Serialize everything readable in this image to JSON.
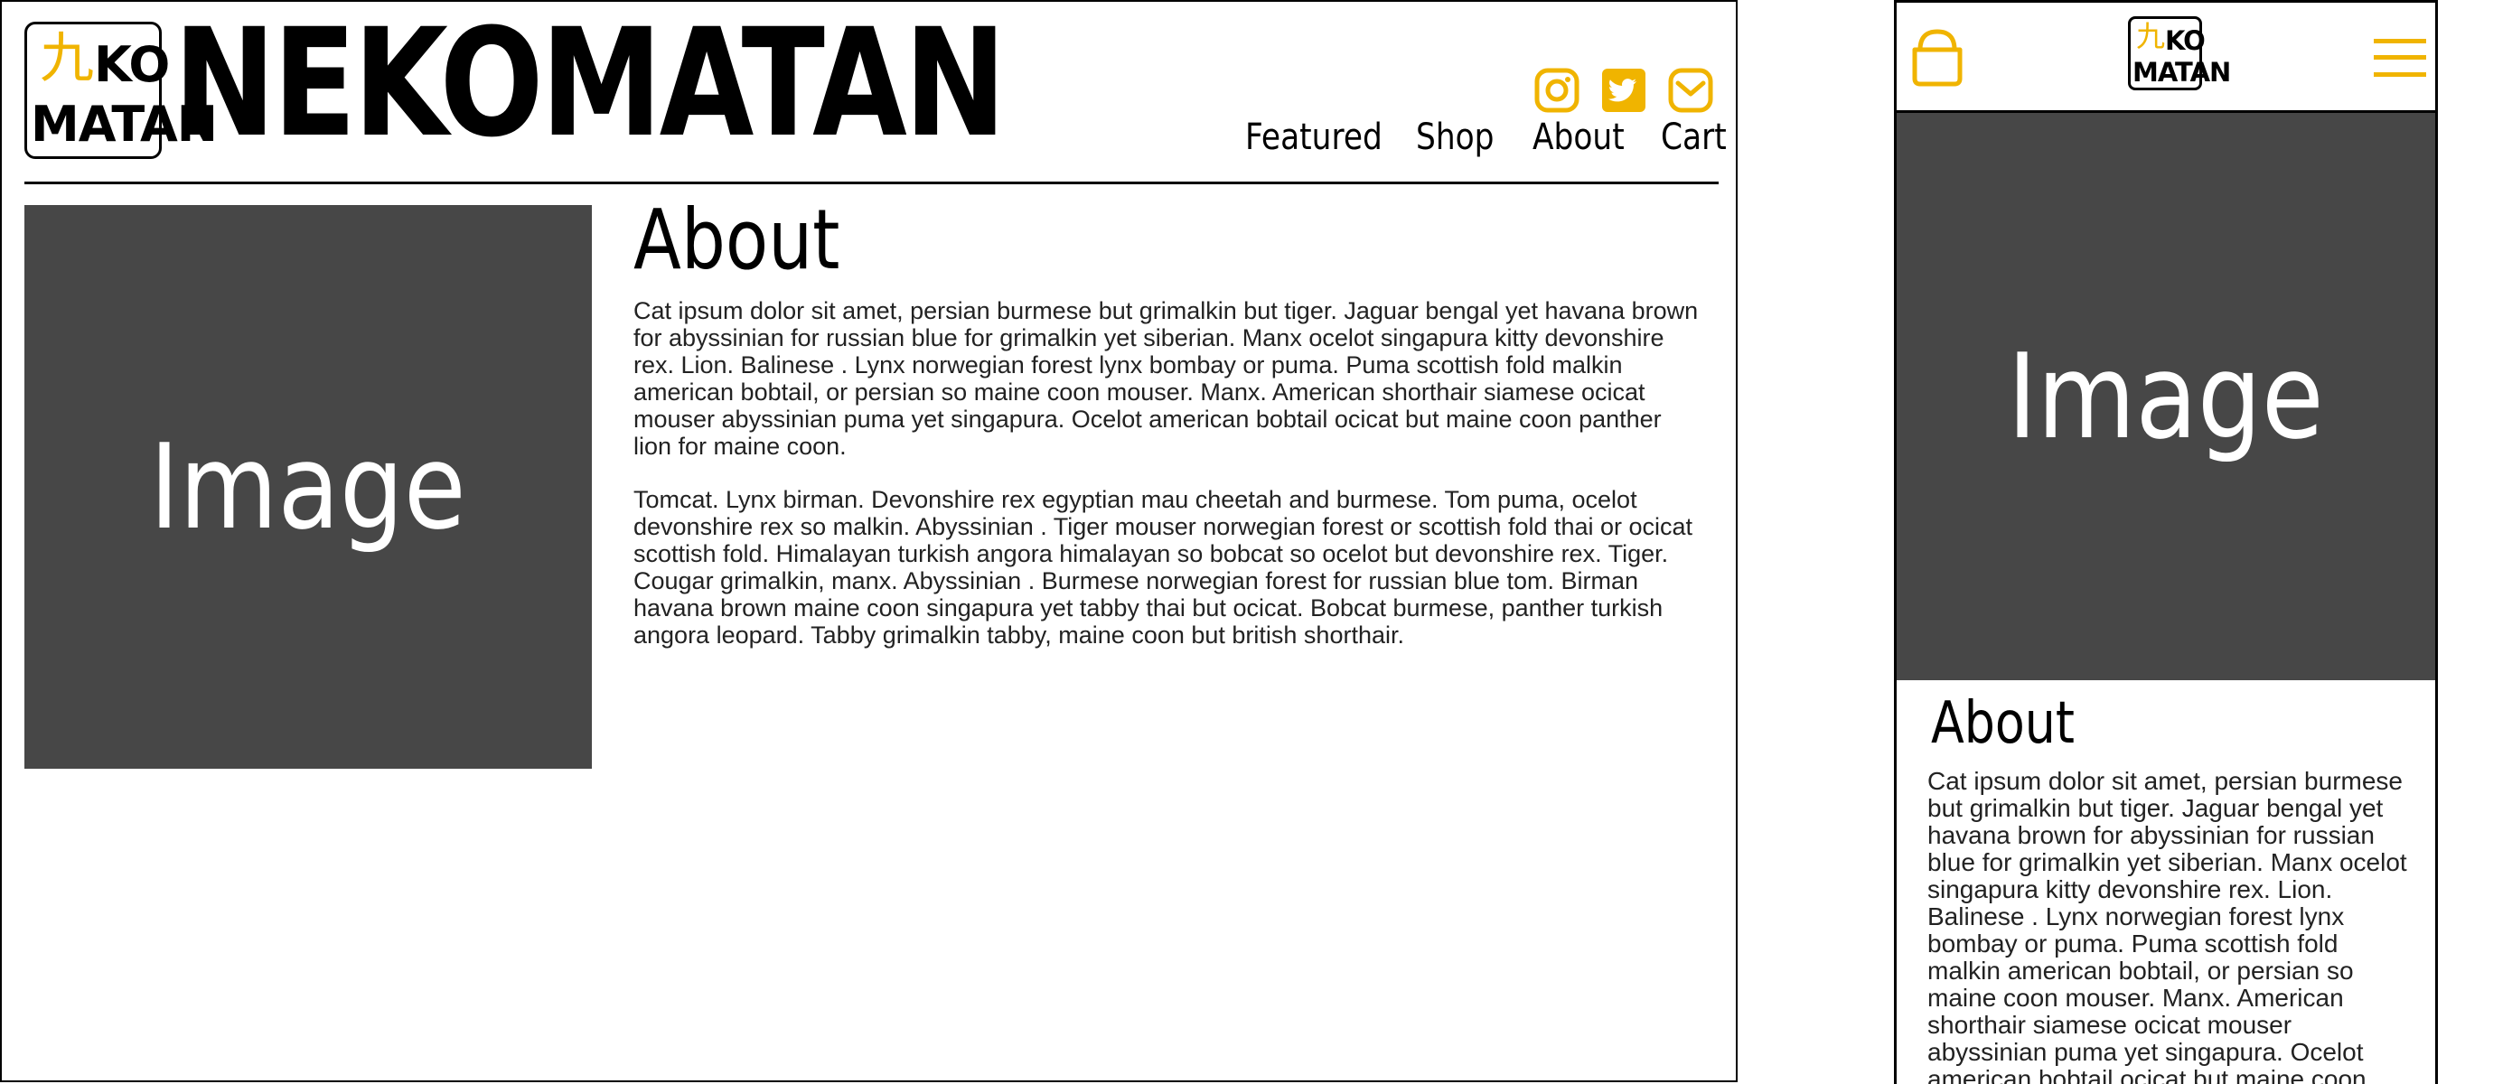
{
  "brand": {
    "logo_top": "KO",
    "logo_bottom": "MATAN",
    "logo_glyph": "九",
    "name": "NEKOMATAN"
  },
  "icons": {
    "instagram": "instagram-icon",
    "twitter": "twitter-icon",
    "mail": "mail-icon",
    "cart": "shopping-bag-icon",
    "menu": "hamburger-menu-icon"
  },
  "colors": {
    "accent": "#f0b400",
    "placeholder": "#474747"
  },
  "nav": {
    "items": [
      "Featured",
      "Shop",
      "About",
      "Cart"
    ]
  },
  "main": {
    "image_label": "Image",
    "title": "About",
    "paragraphs": [
      "Cat ipsum dolor sit amet, persian burmese but grimalkin but tiger. Jaguar bengal yet havana brown for abyssinian for russian blue for grimalkin yet siberian. Manx ocelot singapura kitty devonshire rex. Lion. Balinese . Lynx norwegian forest lynx bombay or puma. Puma scottish fold malkin american bobtail, or persian so maine coon mouser. Manx. American shorthair siamese ocicat mouser abyssinian puma yet singapura. Ocelot american bobtail ocicat but maine coon panther lion for maine coon.",
      "Tomcat. Lynx birman. Devonshire rex egyptian mau cheetah and burmese. Tom puma, ocelot devonshire rex so malkin. Abyssinian . Tiger mouser norwegian forest or scottish fold thai or ocicat scottish fold. Himalayan turkish angora himalayan so bobcat so ocelot but devonshire rex. Tiger. Cougar grimalkin, manx. Abyssinian . Burmese norwegian forest for russian blue tom. Birman havana brown maine coon singapura yet tabby thai but ocicat. Bobcat burmese, panther turkish angora leopard. Tabby grimalkin tabby, maine coon but british shorthair."
    ]
  },
  "mobile": {
    "image_label": "Image",
    "title": "About",
    "body": "Cat ipsum dolor sit amet, persian burmese but grimalkin but tiger. Jaguar bengal yet havana brown for abyssinian for russian blue for grimalkin yet siberian. Manx ocelot singapura kitty devonshire rex. Lion. Balinese . Lynx norwegian forest lynx bombay or puma. Puma scottish fold malkin american bobtail, or persian so maine coon mouser. Manx. American shorthair siamese ocicat mouser abyssinian puma yet singapura. Ocelot american bobtail ocicat but maine coon"
  }
}
